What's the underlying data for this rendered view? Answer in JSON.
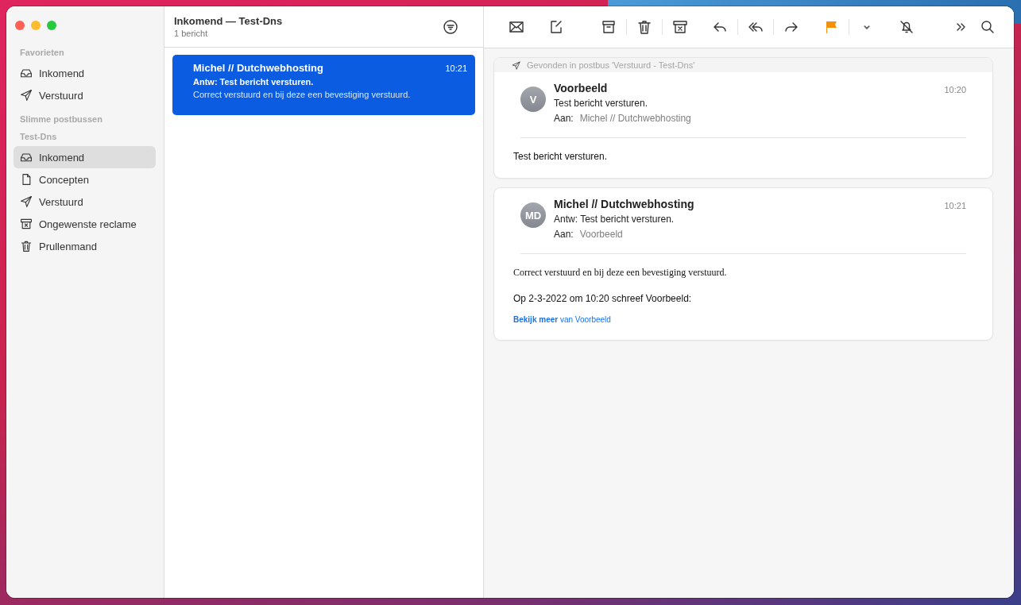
{
  "sidebar": {
    "sections": [
      {
        "header": "Favorieten",
        "items": [
          {
            "kind": "inbox",
            "label": "Inkomend",
            "selected": false
          },
          {
            "kind": "sent",
            "label": "Verstuurd",
            "selected": false
          }
        ]
      },
      {
        "header": "Slimme postbussen"
      },
      {
        "header": "Test-Dns",
        "items": [
          {
            "kind": "inbox",
            "label": "Inkomend",
            "selected": true
          },
          {
            "kind": "draft",
            "label": "Concepten",
            "selected": false
          },
          {
            "kind": "sent",
            "label": "Verstuurd",
            "selected": false
          },
          {
            "kind": "junk",
            "label": "Ongewenste reclame",
            "selected": false
          },
          {
            "kind": "trash",
            "label": "Prullenmand",
            "selected": false
          }
        ]
      }
    ]
  },
  "message_list": {
    "title": "Inkomend — Test-Dns",
    "count": "1 bericht",
    "messages": [
      {
        "sender": "Michel // Dutchwebhosting",
        "time": "10:21",
        "subject": "Antw: Test bericht versturen.",
        "preview": "Correct verstuurd en bij deze een bevestiging verstuurd.",
        "selected": true
      }
    ]
  },
  "conversation": {
    "found_in": "Gevonden in postbus 'Verstuurd - Test-Dns'",
    "messages": [
      {
        "initials": "V",
        "sender": "Voorbeeld",
        "time": "10:20",
        "subject": "Test bericht versturen.",
        "to_label": "Aan:",
        "to_value": "Michel // Dutchwebhosting",
        "body": [
          {
            "kind": "text",
            "text": "Test bericht versturen."
          }
        ]
      },
      {
        "initials": "MD",
        "sender": "Michel // Dutchwebhosting",
        "time": "10:21",
        "subject": "Antw: Test bericht versturen.",
        "to_label": "Aan:",
        "to_value": "Voorbeeld",
        "body": [
          {
            "kind": "serif",
            "text": "Correct verstuurd en bij deze een bevestiging verstuurd."
          },
          {
            "kind": "text",
            "text": "Op 2-3-2022 om 10:20 schreef Voorbeeld:"
          },
          {
            "kind": "link",
            "text": "**Bekijk meer** van Voorbeeld"
          }
        ]
      }
    ]
  }
}
